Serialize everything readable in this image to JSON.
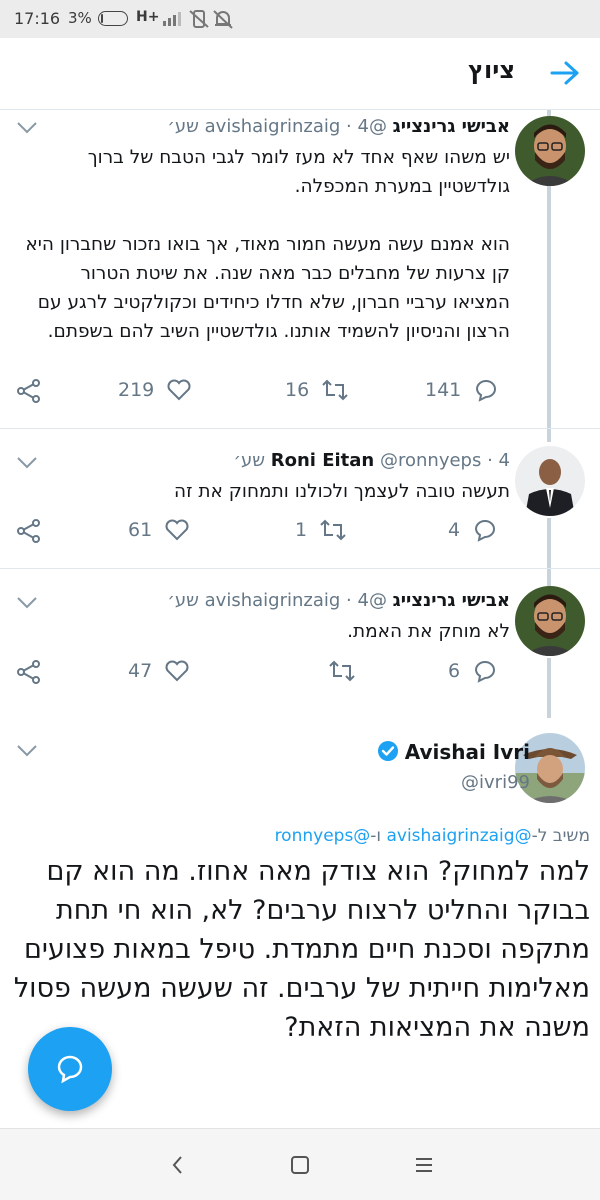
{
  "status_bar": {
    "time": "17:16",
    "battery": "3%",
    "battery_level": 0.03,
    "network": "H+"
  },
  "header": {
    "title": "ציוץ",
    "back_icon": "arrow-right-icon"
  },
  "tweets": [
    {
      "name": "אבישי גרינצייג",
      "handle": "@avishaigrinzaig",
      "time": "· 4 שע׳",
      "body": [
        "יש משהו שאף אחד לא מעז לומר לגבי הטבח של ברוך גולדשטיין במערת המכפלה.",
        "הוא אמנם עשה מעשה חמור מאוד, אך בואו נזכור שחברון היא קן צרעות של מחבלים כבר מאה שנה. את שיטת הטרור המציאו ערביי חברון, שלא חדלו כיחידים וכקולקטיב לרגע עם הרצון והניסיון להשמיד אותנו. גולדשטיין השיב להם בשפתם."
      ],
      "replies": "141",
      "retweets": "16",
      "likes": "219"
    },
    {
      "name": "Roni Eitan",
      "handle": "@ronnyeps",
      "time": "· 4 שע׳",
      "body": [
        "תעשה טובה לעצמך ולכולנו ותמחוק את זה"
      ],
      "replies": "4",
      "retweets": "1",
      "likes": "61"
    },
    {
      "name": "אבישי גרינצייג",
      "handle": "@avishaigrinzaig",
      "time": "· 4 שע׳",
      "body": [
        "לא מוחק את האמת."
      ],
      "replies": "6",
      "retweets": "",
      "likes": "47"
    }
  ],
  "main_tweet": {
    "name": "Avishai Ivri",
    "handle": "@ivri99",
    "reply_prefix": "משיב ל-",
    "reply_mention_1": "@avishaigrinzaig",
    "reply_and": " ו-",
    "reply_mention_2": "@ronnyeps",
    "body": "למה למחוק? הוא צודק מאה אחוז. מה הוא קם בבוקר והחליט לרצוח ערבים? לא, הוא חי תחת מתקפה וסכנת חיים מתמדת. טיפל במאות פצועים מאלימות חייתית של ערבים. זה שעשה מעשה פסול משנה את המציאות הזאת?"
  },
  "colors": {
    "accent": "#1da1f2",
    "text": "#14171a",
    "muted": "#657786",
    "thread_line": "#c8d3db"
  }
}
